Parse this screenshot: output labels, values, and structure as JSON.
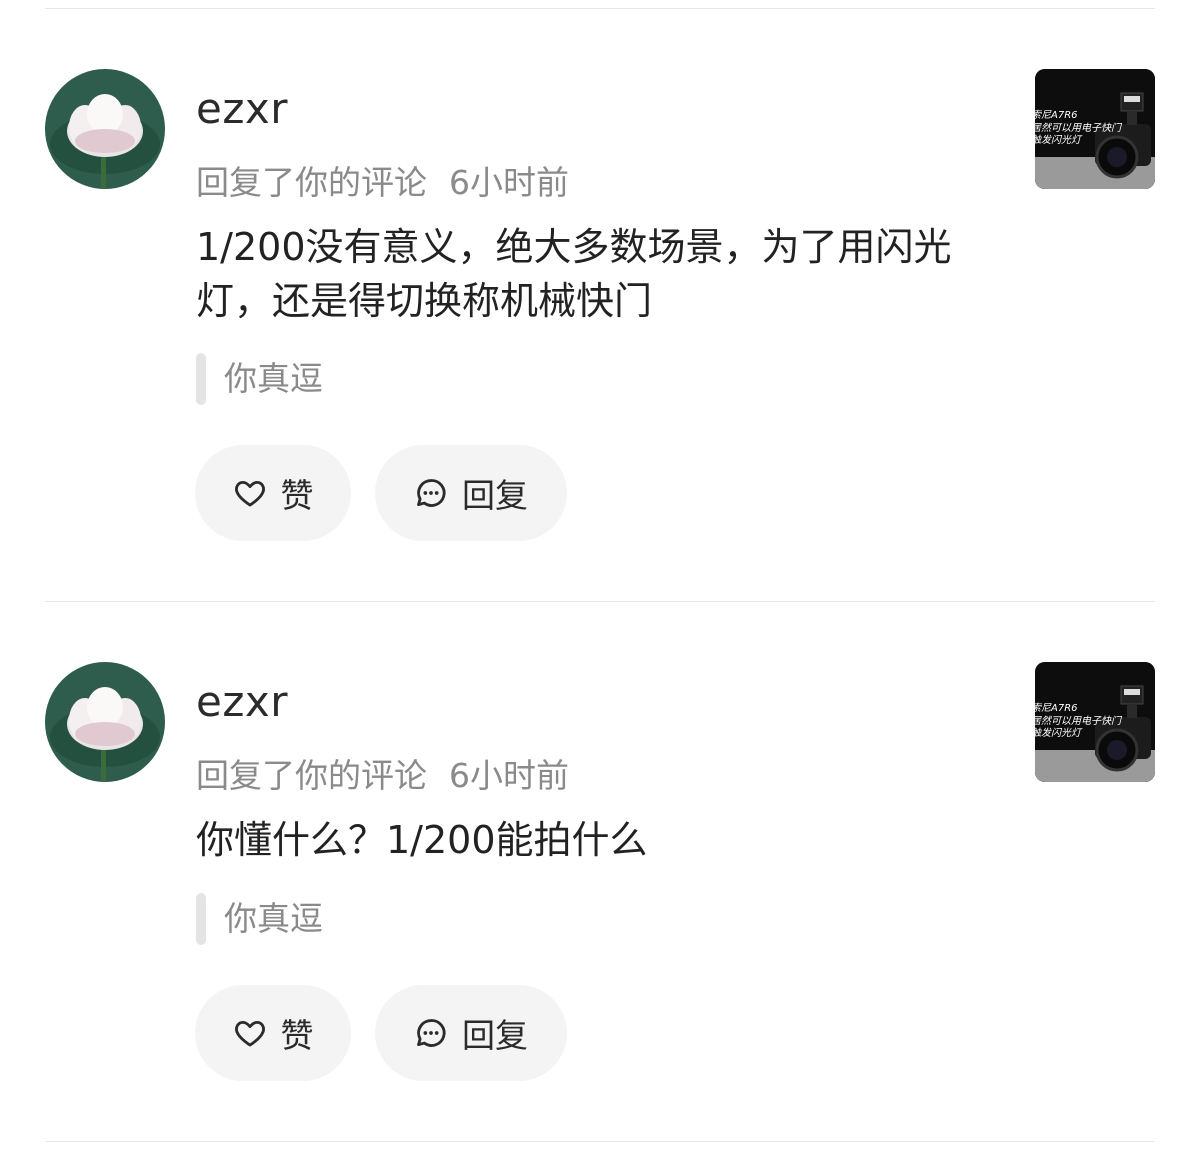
{
  "comments": [
    {
      "username": "ezxr",
      "action": "回复了你的评论",
      "time": "6小时前",
      "content": "1/200没有意义，绝大多数场景，为了用闪光灯，还是得切换称机械快门",
      "quote": "你真逗",
      "like_label": "赞",
      "reply_label": "回复",
      "thumbnail_lines": [
        "索尼A7R6",
        "居然可以用电子快门",
        "触发闪光灯"
      ]
    },
    {
      "username": "ezxr",
      "action": "回复了你的评论",
      "time": "6小时前",
      "content": "你懂什么？1/200能拍什么",
      "quote": "你真逗",
      "like_label": "赞",
      "reply_label": "回复",
      "thumbnail_lines": [
        "索尼A7R6",
        "居然可以用电子快门",
        "触发闪光灯"
      ]
    }
  ],
  "icons": {
    "like": "heart-outline-icon",
    "reply": "chat-bubble-icon"
  }
}
